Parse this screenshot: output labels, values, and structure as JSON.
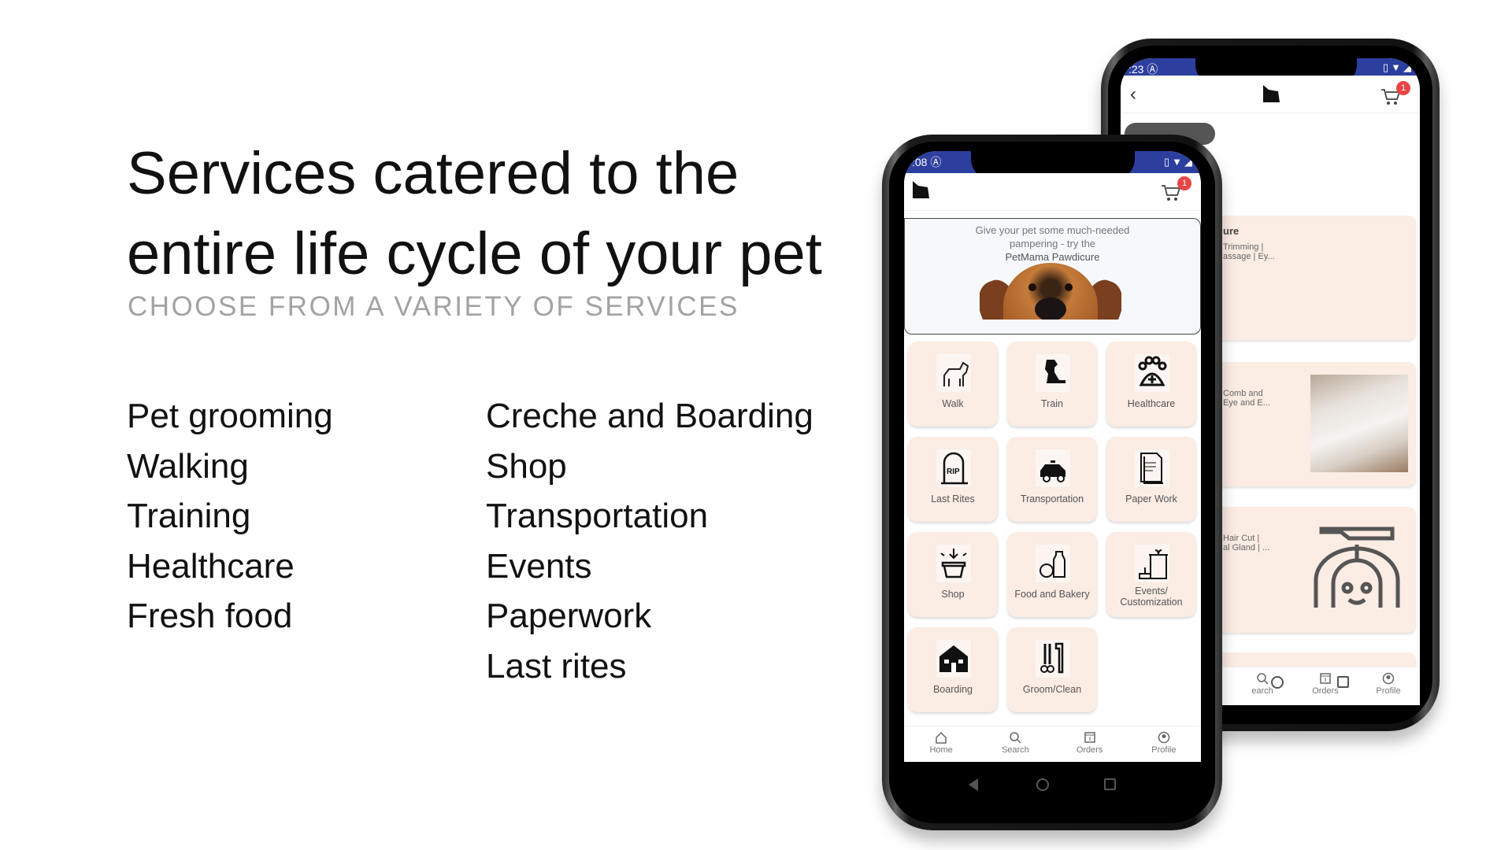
{
  "hero": {
    "title_line1": "Services catered to the",
    "title_line2": "entire life cycle of your pet",
    "subtitle": "CHOOSE FROM A VARIETY OF SERVICES"
  },
  "services_col1": [
    "Pet grooming",
    "Walking",
    "Training",
    "Healthcare",
    "Fresh food"
  ],
  "services_col2": [
    "Creche and Boarding",
    "Shop",
    "Transportation",
    "Events",
    "Paperwork",
    "Last rites"
  ],
  "colors": {
    "status_bar": "#2d3f9e",
    "tile_bg": "#fbece4",
    "badge": "#e84646"
  },
  "front_phone": {
    "time": ":08",
    "cart_badge": "1",
    "banner": {
      "line1": "Give your pet some much-needed",
      "line2": "pampering - try the",
      "line3": "PetMama Pawdicure"
    },
    "tiles": [
      {
        "label": "Walk",
        "icon": "dog-leash-icon"
      },
      {
        "label": "Train",
        "icon": "sitting-dog-icon"
      },
      {
        "label": "Healthcare",
        "icon": "paw-plus-icon"
      },
      {
        "label": "Last Rites",
        "icon": "tombstone-icon"
      },
      {
        "label": "Transportation",
        "icon": "taxi-icon"
      },
      {
        "label": "Paper Work",
        "icon": "document-icon"
      },
      {
        "label": "Shop",
        "icon": "basket-icon"
      },
      {
        "label": "Food and Bakery",
        "icon": "food-icon"
      },
      {
        "label": "Events/ Customization",
        "icon": "gift-cake-icon"
      },
      {
        "label": "Boarding",
        "icon": "house-icon"
      },
      {
        "label": "Groom/Clean",
        "icon": "scissors-comb-icon"
      }
    ],
    "nav": [
      "Home",
      "Search",
      "Orders",
      "Profile"
    ]
  },
  "back_phone": {
    "time": ":23",
    "cart_badge": "1",
    "cards": [
      {
        "title": "ure",
        "line1": "Trimming |",
        "line2": "assage | Ey..."
      },
      {
        "title": "",
        "line1": "Comb and",
        "line2": "Eye and E..."
      },
      {
        "title": "",
        "line1": "Hair Cut |",
        "line2": "al Gland | ..."
      }
    ],
    "nav": [
      "earch",
      "Orders",
      "Profile"
    ]
  }
}
